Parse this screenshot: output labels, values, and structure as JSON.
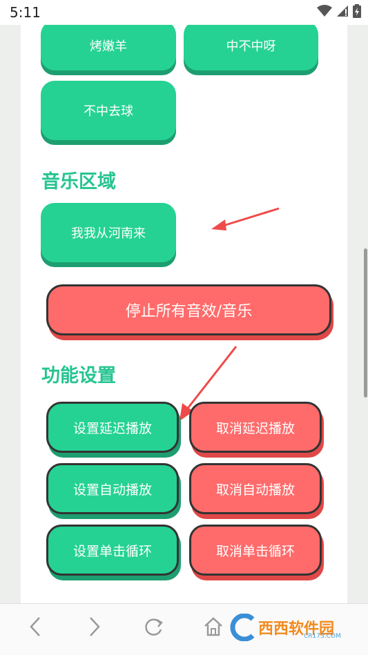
{
  "status_bar": {
    "time": "5:11"
  },
  "sound_buttons": [
    "烤嫩羊",
    "中不中呀",
    "不中去球"
  ],
  "music_section": {
    "title": "音乐区域",
    "button": "我我从河南来"
  },
  "stop_button": "停止所有音效/音乐",
  "settings_section": {
    "title": "功能设置",
    "set_delay": "设置延迟播放",
    "cancel_delay": "取消延迟播放",
    "set_auto": "设置自动播放",
    "cancel_auto": "取消自动播放",
    "set_loop": "设置单击循环",
    "cancel_loop": "取消单击循环"
  },
  "nav_icons": [
    "back-icon",
    "forward-icon",
    "refresh-icon",
    "home-icon"
  ],
  "watermark": {
    "brand": "西西软件园",
    "site": "CR173.COM"
  },
  "colors": {
    "green": "#25d294",
    "red": "#ff6b6b",
    "title_green": "#25c490"
  }
}
